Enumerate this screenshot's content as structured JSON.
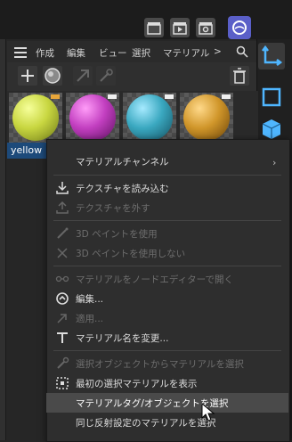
{
  "topbar": {
    "icons": [
      "clapper-icon",
      "play-clapper-icon",
      "settings-clapper-icon",
      "render-icon"
    ]
  },
  "menubar": {
    "items": [
      "作成",
      "編集",
      "ビュー",
      "選択",
      "マテリアル",
      ">"
    ]
  },
  "materials": [
    {
      "name": "yellow",
      "color": "#c8d640"
    },
    {
      "name": "",
      "color": "#c23fc0"
    },
    {
      "name": "",
      "color": "#3aa8c0"
    },
    {
      "name": "",
      "color": "#d0962a"
    }
  ],
  "context_menu": {
    "items": [
      {
        "label": "マテリアルチャンネル",
        "state": "enabled",
        "submenu": true,
        "icon": ""
      },
      {
        "label": "テクスチャを読み込む",
        "state": "enabled",
        "icon": "load-texture-icon"
      },
      {
        "label": "テクスチャを外す",
        "state": "disabled",
        "icon": "remove-texture-icon"
      },
      {
        "label": "3D ペイントを使用",
        "state": "disabled",
        "icon": "brush-icon"
      },
      {
        "label": "3D ペイントを使用しない",
        "state": "disabled",
        "icon": "no-brush-icon"
      },
      {
        "label": "マテリアルをノードエディターで開く",
        "state": "disabled",
        "icon": "node-icon"
      },
      {
        "label": "編集...",
        "state": "enabled",
        "icon": "edit-icon"
      },
      {
        "label": "適用...",
        "state": "disabled",
        "icon": "apply-icon"
      },
      {
        "label": "マテリアル名を変更...",
        "state": "enabled",
        "icon": "rename-icon"
      },
      {
        "label": "選択オブジェクトからマテリアルを選択",
        "state": "disabled",
        "icon": "eyedropper-icon"
      },
      {
        "label": "最初の選択マテリアルを表示",
        "state": "enabled",
        "icon": "show-selection-icon"
      },
      {
        "label": "マテリアルタグ/オブジェクトを選択",
        "state": "highlighted",
        "icon": ""
      },
      {
        "label": "同じ反射設定のマテリアルを選択",
        "state": "enabled",
        "icon": ""
      }
    ]
  }
}
